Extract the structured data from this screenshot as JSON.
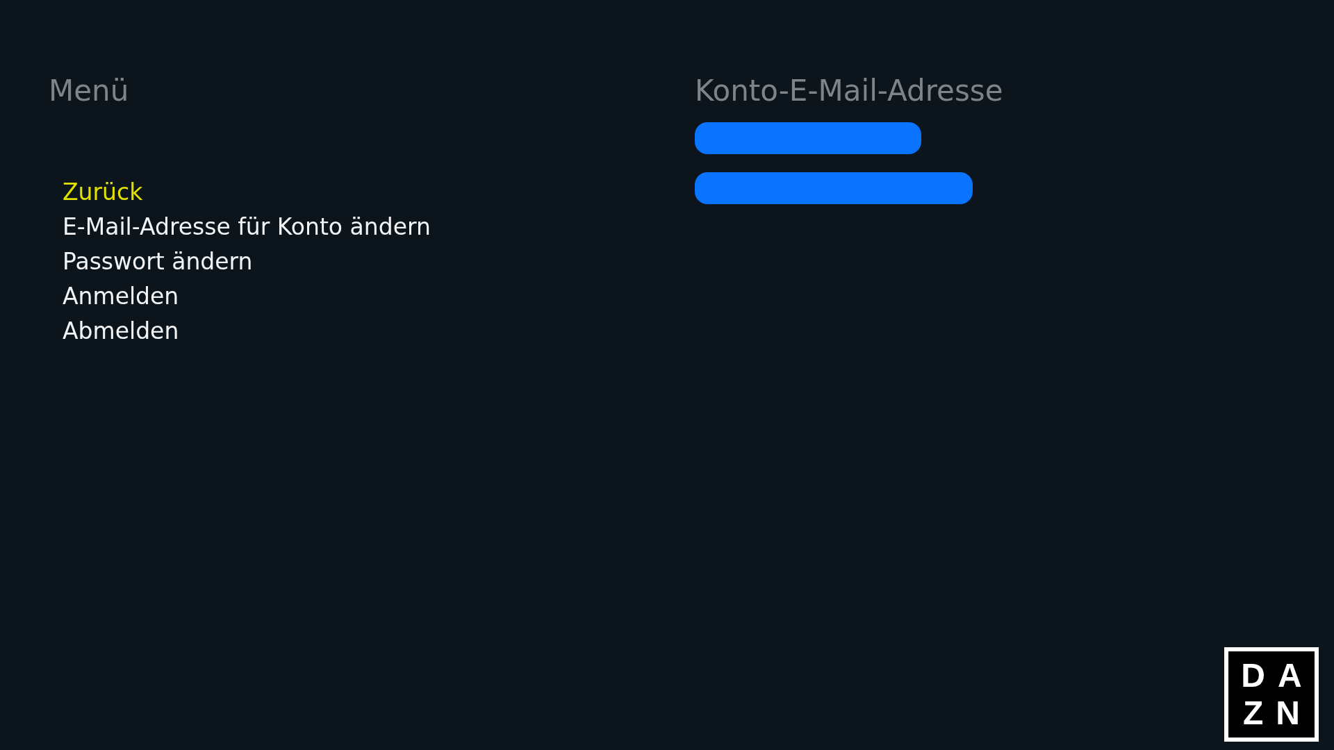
{
  "menu": {
    "title": "Menü",
    "items": [
      {
        "label": "Zurück",
        "selected": true
      },
      {
        "label": "E-Mail-Adresse für Konto ändern",
        "selected": false
      },
      {
        "label": "Passwort ändern",
        "selected": false
      },
      {
        "label": "Anmelden",
        "selected": false
      },
      {
        "label": "Abmelden",
        "selected": false
      }
    ]
  },
  "account": {
    "title": "Konto-E-Mail-Adresse",
    "lines": [
      {
        "kind": "redacted"
      },
      {
        "kind": "redacted"
      }
    ]
  },
  "logo": {
    "rows": [
      "DA",
      "ZN"
    ]
  }
}
